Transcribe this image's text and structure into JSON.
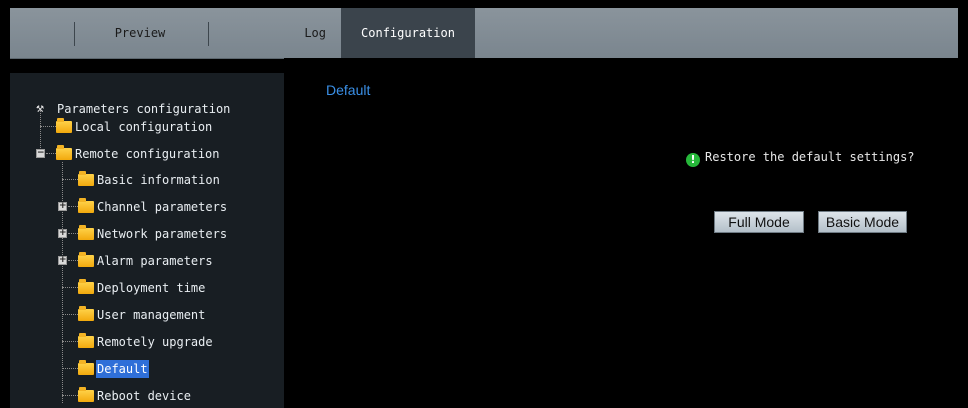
{
  "tabs": {
    "preview": "Preview",
    "log": "Log",
    "configuration": "Configuration"
  },
  "tree": {
    "root": "Parameters configuration",
    "local": "Local configuration",
    "remote": "Remote configuration",
    "basic_information": "Basic information",
    "channel_parameters": "Channel parameters",
    "network_parameters": "Network parameters",
    "alarm_parameters": "Alarm parameters",
    "deployment_time": "Deployment time",
    "user_management": "User management",
    "remotely_upgrade": "Remotely upgrade",
    "default": "Default",
    "reboot_device": "Reboot device"
  },
  "main": {
    "title": "Default",
    "prompt": "Restore the default settings?",
    "full_mode": "Full Mode",
    "basic_mode": "Basic Mode"
  },
  "icons": {
    "root": "tools-icon",
    "folder": "folder-icon",
    "info": "info-icon",
    "collapse": "minus-expander-icon",
    "expand": "plus-expander-icon"
  },
  "colors": {
    "tab_bar": "#808a93",
    "active_tab": "#3b444c",
    "sidebar_bg": "#181e23",
    "title_blue": "#3a8fe6",
    "selection": "#2f6fd8",
    "info_green": "#26b83a"
  }
}
